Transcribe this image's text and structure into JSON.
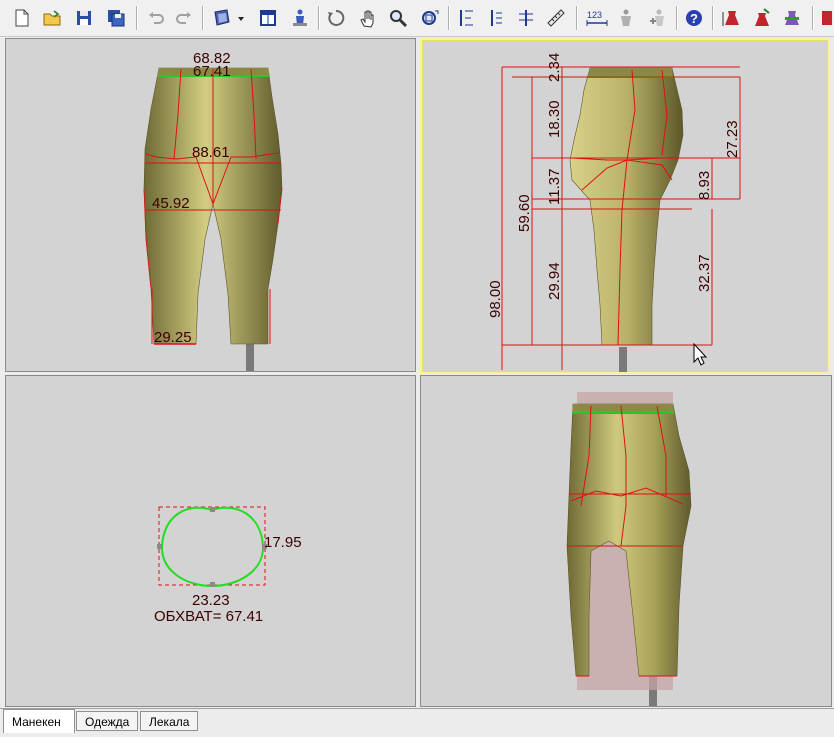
{
  "toolbar": {
    "icons": [
      "new-file-icon",
      "open-folder-icon",
      "save-icon",
      "save-all-icon",
      "undo-icon",
      "redo-icon",
      "mannequin-view-icon",
      "dropdown-arrow-icon",
      "window-layout-icon",
      "mannequin-settings-icon",
      "rotate-icon",
      "pan-hand-icon",
      "zoom-icon",
      "fit-view-icon",
      "vertical-measure-icon",
      "vertical-measure-2-icon",
      "vertical-measure-3-icon",
      "ruler-icon",
      "dimensions-icon",
      "mannequin-gray-icon",
      "mannequin-add-icon",
      "help-icon",
      "dress-red-icon",
      "dress-edit-icon",
      "dress-green-icon"
    ],
    "dimensions_label": "123"
  },
  "front_view": {
    "waist_upper": "68.82",
    "waist": "67.41",
    "hip": "88.61",
    "thigh": "45.92",
    "knee": "29.25"
  },
  "side_view": {
    "top_gap": "2.34",
    "waist_to_hip": "18.30",
    "hip_to_crotch": "11.37",
    "crotch_to_knee": "29.94",
    "waist_to_knee": "59.60",
    "total_height": "98.00",
    "waist_to_hip_back": "27.23",
    "hip_to_crotch_back": "8.93",
    "crotch_to_knee_back": "32.37"
  },
  "section_view": {
    "depth": "17.95",
    "width": "23.23",
    "girth_label": "ОБХВАТ= 67.41"
  },
  "tabs": [
    "Манекен",
    "Одежда",
    "Лекала"
  ]
}
